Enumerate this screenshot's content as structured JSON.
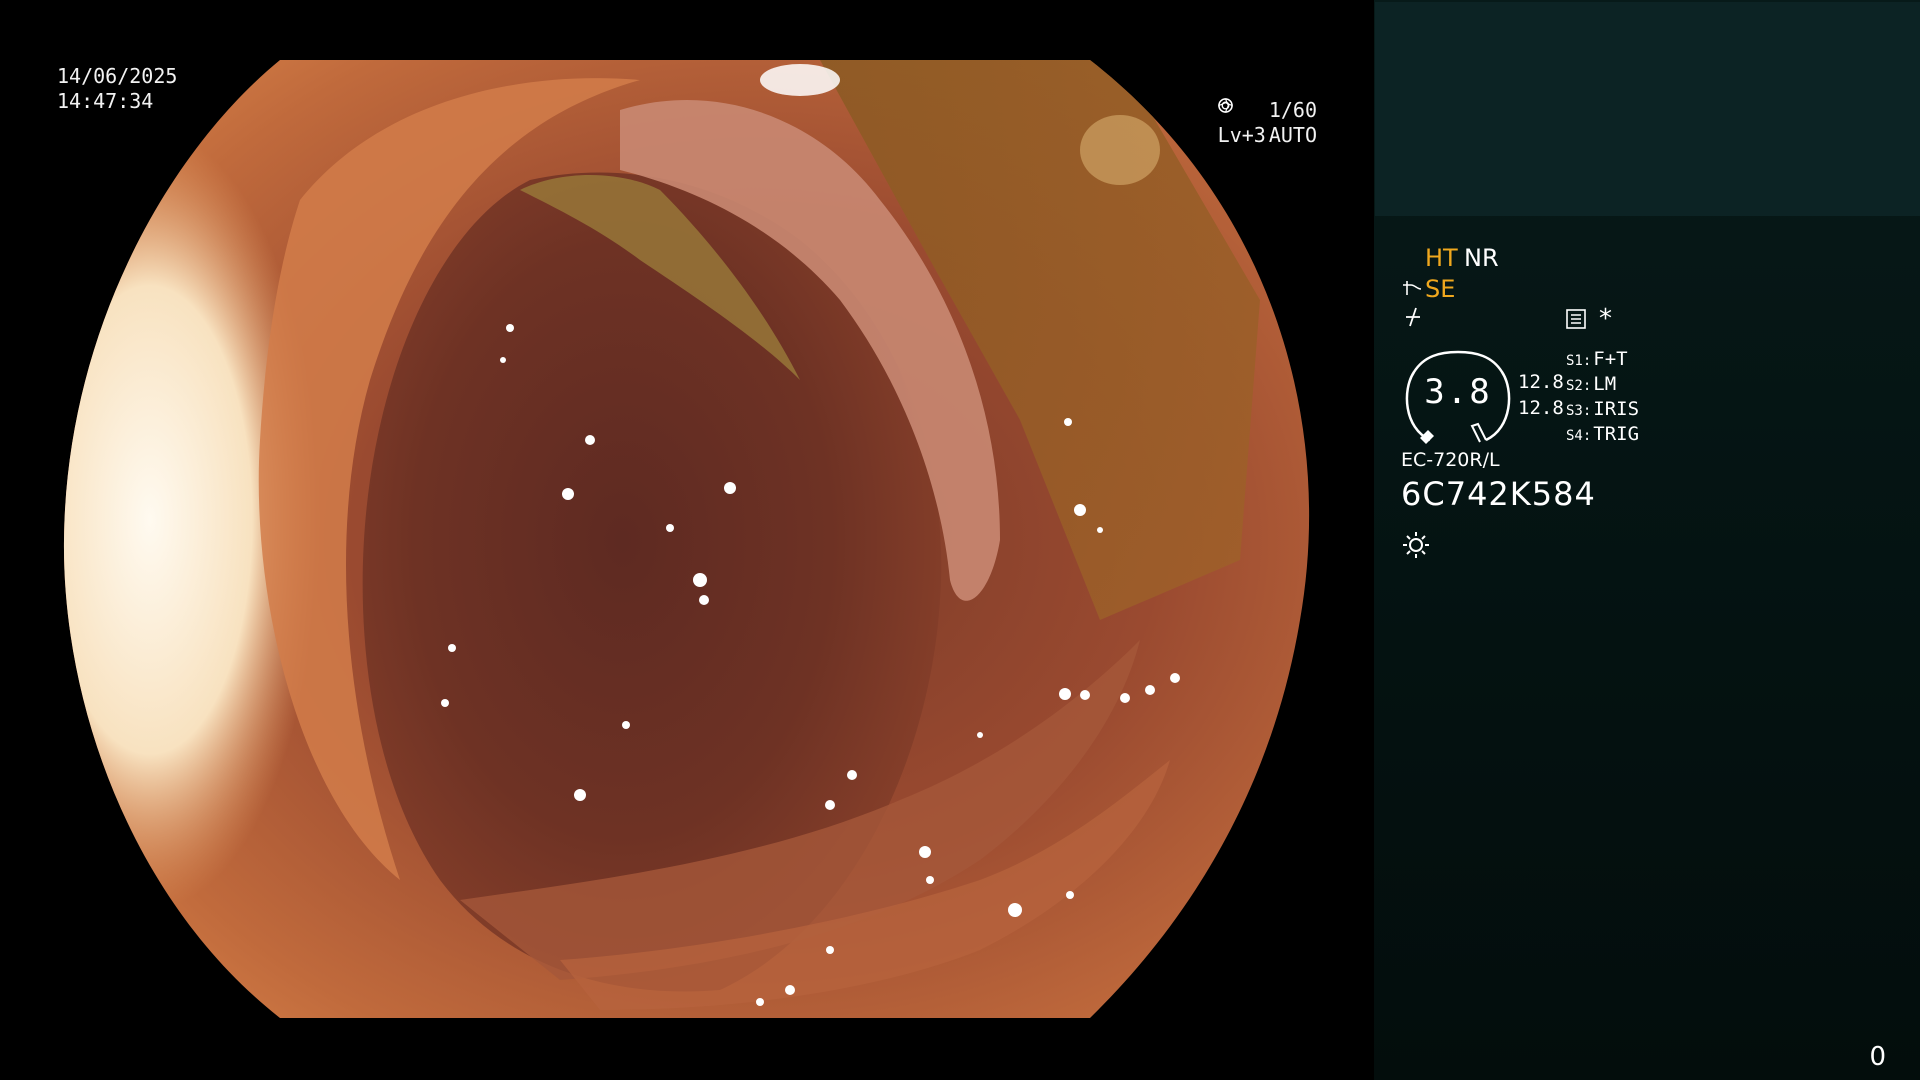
{
  "overlay": {
    "date": "14/06/2025",
    "time": "14:47:34",
    "shutter": "1/60",
    "shutter_icon": "aperture-icon",
    "level": "Lv+3",
    "exposure_mode": "AUTO",
    "exposure_icon": "iris-icon"
  },
  "panel": {
    "mode_ht": "HT",
    "mode_nr": "NR",
    "mode_se": "SE",
    "zoom": "3.8",
    "sub_value_1": "12.8",
    "sub_value_2": "12.8",
    "switches": [
      {
        "key": "S1:",
        "label": "F+T"
      },
      {
        "key": "S2:",
        "label": "LM"
      },
      {
        "key": "S3:",
        "label": "IRIS"
      },
      {
        "key": "S4:",
        "label": "TRIG"
      }
    ],
    "star": "*",
    "scope_model": "EC-720R/L",
    "serial": "6C742K584",
    "counter": "0"
  },
  "colors": {
    "mode_active": "#f0a81e",
    "panel_bg": "#041211",
    "panel_top": "#0c2324"
  }
}
